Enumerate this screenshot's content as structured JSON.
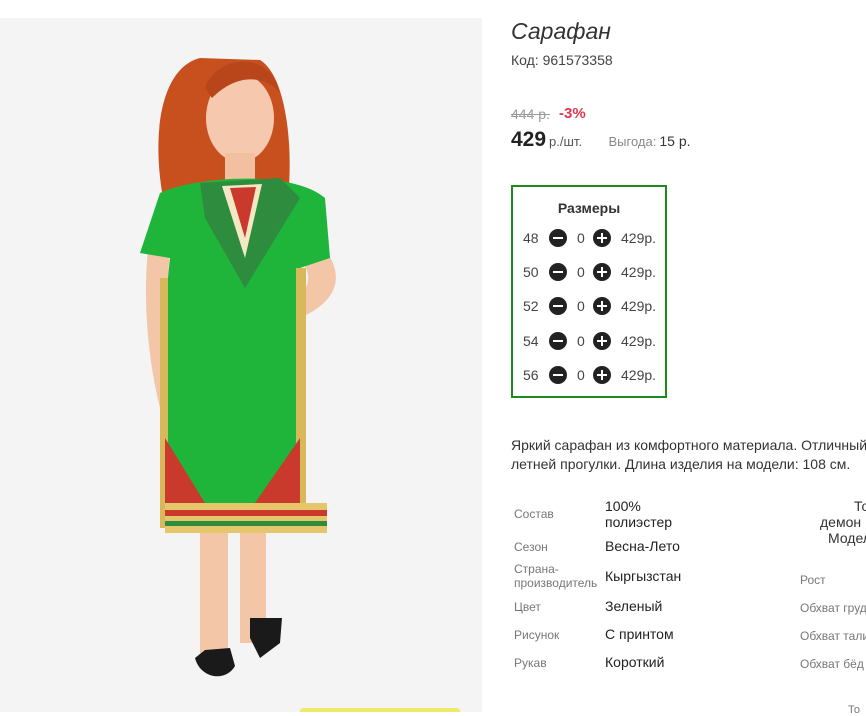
{
  "product": {
    "title": "Сарафан",
    "code": "Код: 961573358",
    "old_price": "444 р.",
    "discount": "-3%",
    "price": "429",
    "unit": "р./шт.",
    "benefit_label": "Выгода:",
    "benefit_value": "15 р."
  },
  "sizes": {
    "title": "Размеры",
    "rows": [
      {
        "size": "48",
        "qty": "0",
        "price": "429р."
      },
      {
        "size": "50",
        "qty": "0",
        "price": "429р."
      },
      {
        "size": "52",
        "qty": "0",
        "price": "429р."
      },
      {
        "size": "54",
        "qty": "0",
        "price": "429р."
      },
      {
        "size": "56",
        "qty": "0",
        "price": "429р."
      }
    ]
  },
  "description": {
    "line1": "Яркий сарафан из комфортного материала. Отличный",
    "line2": "летней прогулки. Длина изделия на модели: 108 см."
  },
  "properties": {
    "composition_label": "Состав",
    "composition_value_1": "100%",
    "composition_value_2": "полиэстер",
    "season_label": "Сезон",
    "season_value": "Весна-Лето",
    "country_label_1": "Страна-",
    "country_label_2": "производитель",
    "country_value": "Кыргызстан",
    "color_label": "Цвет",
    "color_value": "Зеленый",
    "pattern_label": "Рисунок",
    "pattern_value": "С принтом",
    "sleeve_label": "Рукав",
    "sleeve_value": "Короткий"
  },
  "model": {
    "head_1": "То",
    "head_2": "демон",
    "head_3": "Модел",
    "height_label": "Рост",
    "chest_label": "Обхват груд",
    "waist_label": "Обхват тали",
    "hips_label": "Обхват бёд",
    "bottom_trunc": "То"
  },
  "colors": {
    "accent_border": "#1e8a1e",
    "discount": "#e0364f",
    "dress_green": "#1fb53a"
  }
}
